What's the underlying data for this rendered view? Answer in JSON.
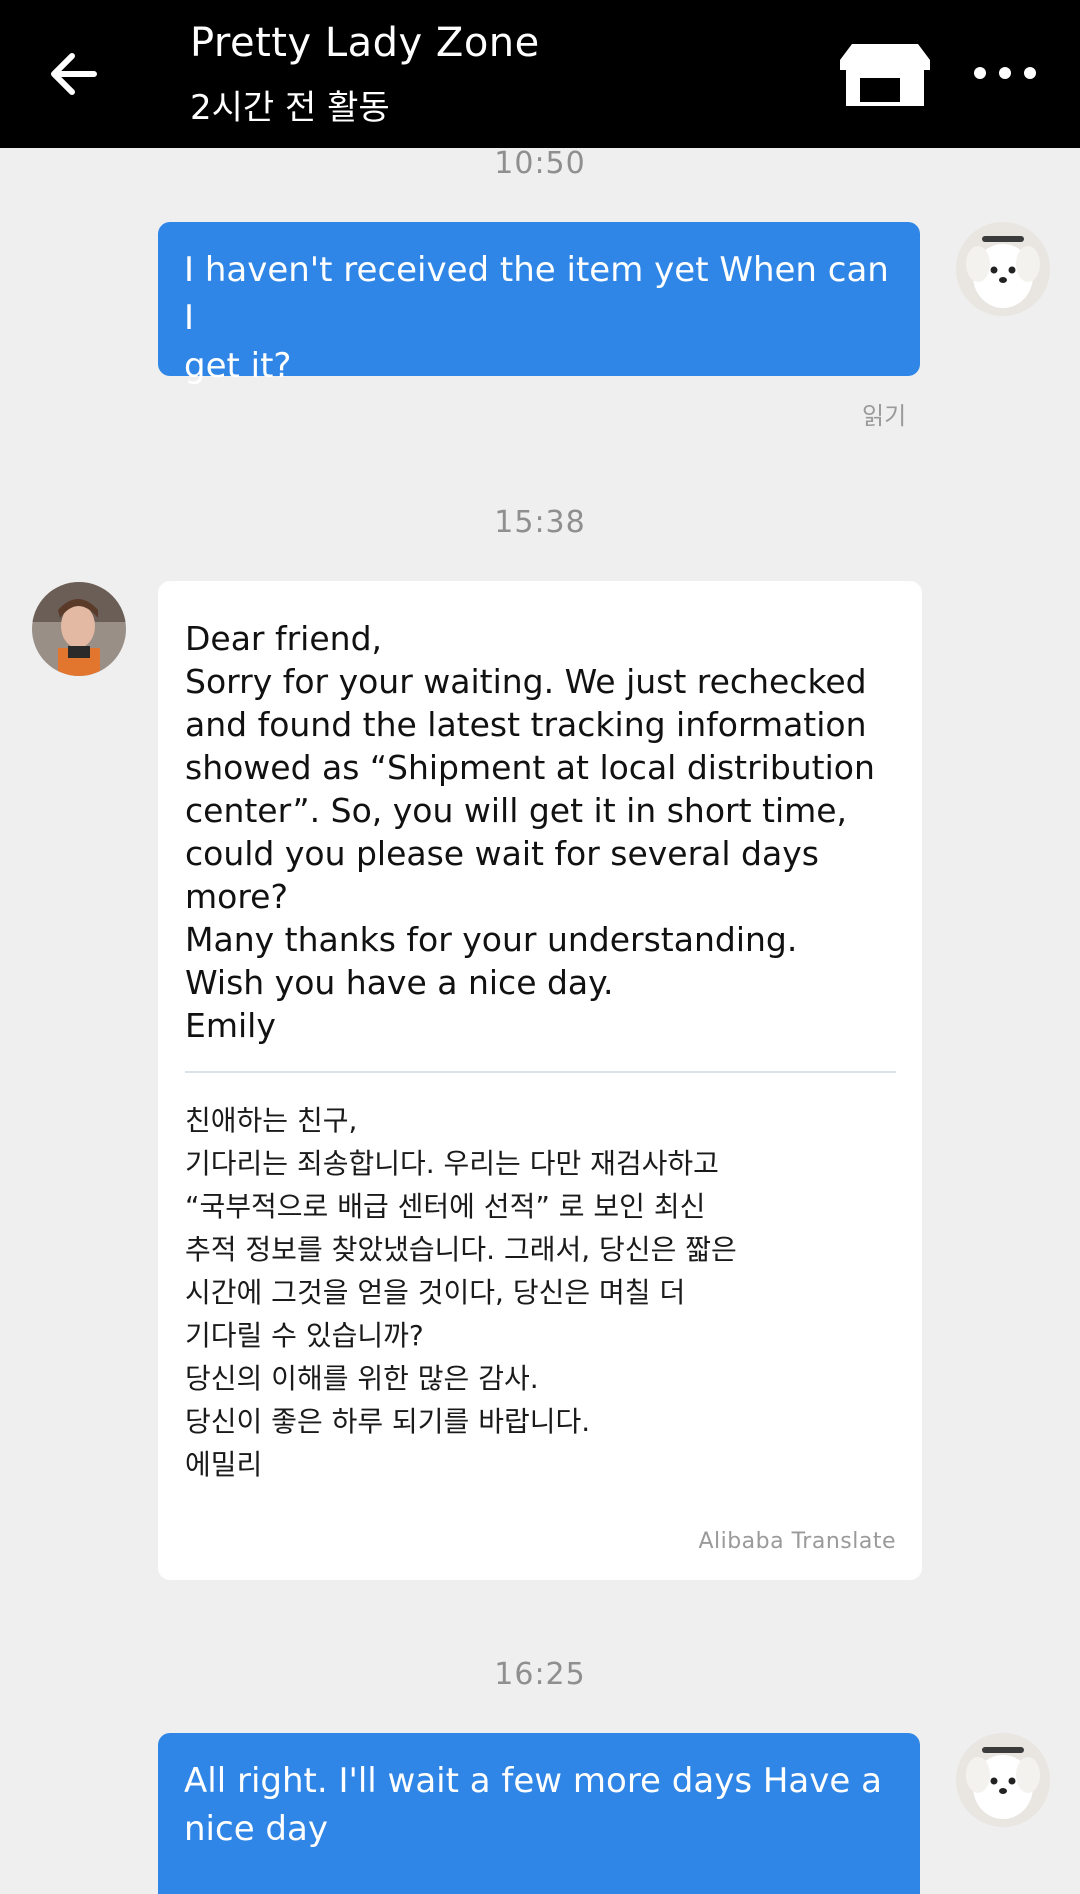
{
  "header": {
    "title": "Pretty Lady Zone",
    "subtitle": "2시간 전 활동",
    "icons": {
      "back": "back-arrow-icon",
      "store": "store-icon",
      "more": "more-dots-icon"
    }
  },
  "colors": {
    "header_bg": "#000000",
    "page_bg": "#efefef",
    "outgoing_bubble": "#2f86e6",
    "incoming_bubble": "#ffffff",
    "timestamp": "#8f8f8f"
  },
  "messages": [
    {
      "time": "10:50",
      "direction": "outgoing",
      "lines": [
        "I haven't received the item yet When can I",
        "get it?"
      ],
      "status": "읽기"
    },
    {
      "time": "15:38",
      "direction": "incoming",
      "lines": [
        "Dear friend,",
        "Sorry for your waiting. We just rechecked",
        "and found the latest tracking information",
        "showed as “Shipment at local distribution",
        "center”. So, you will get it in short time,",
        "could you please wait for several days",
        "more?",
        "Many thanks for your understanding.",
        "Wish you have a nice day.",
        "Emily"
      ],
      "translation_lines": [
        "친애하는 친구,",
        "기다리는 죄송합니다. 우리는 다만 재검사하고",
        "“국부적으로 배급 센터에 선적” 로 보인 최신",
        "추적 정보를 찾았냈습니다. 그래서, 당신은 짧은",
        "시간에 그것을 얻을 것이다, 당신은 며칠 더",
        "기다릴 수 있습니까?",
        "당신의 이해를 위한 많은 감사.",
        "당신이 좋은 하루 되기를 바랍니다.",
        "에밀리"
      ],
      "translation_source": "Alibaba Translate"
    },
    {
      "time": "16:25",
      "direction": "outgoing",
      "lines": [
        "All right. I'll wait a few more days Have a",
        "nice day"
      ]
    }
  ]
}
